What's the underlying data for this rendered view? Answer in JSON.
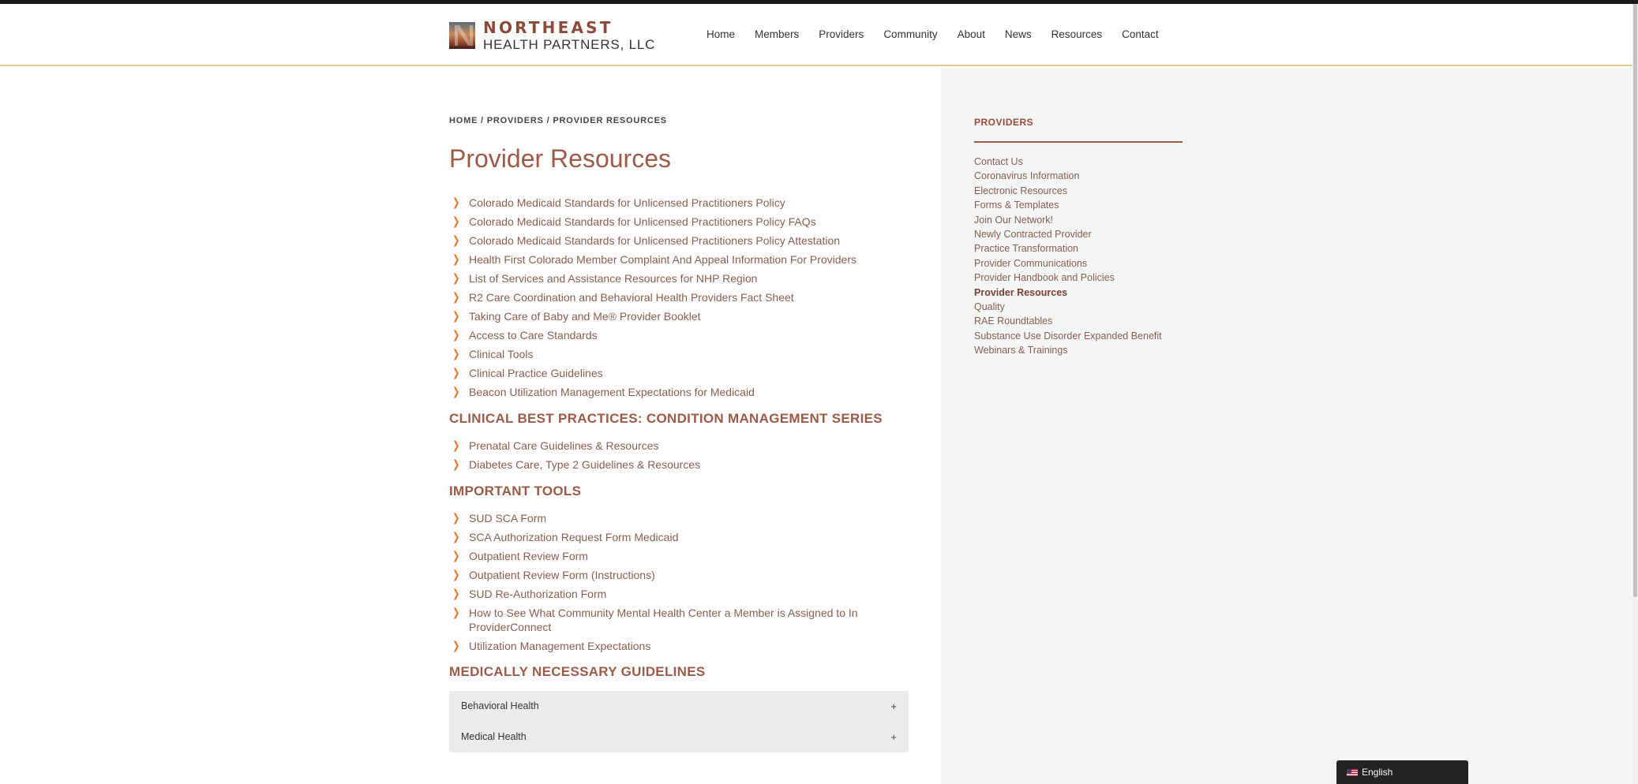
{
  "header": {
    "logo_line1": "NORTHEAST",
    "logo_line2": "HEALTH PARTNERS, LLC",
    "nav": [
      "Home",
      "Members",
      "Providers",
      "Community",
      "About",
      "News",
      "Resources",
      "Contact"
    ]
  },
  "breadcrumb": "HOME / PROVIDERS / PROVIDER RESOURCES",
  "page_title": "Provider Resources",
  "resources": [
    "Colorado Medicaid Standards for Unlicensed Practitioners Policy",
    "Colorado Medicaid Standards for Unlicensed Practitioners Policy FAQs",
    "Colorado Medicaid Standards for Unlicensed Practitioners Policy Attestation",
    "Health First Colorado Member Complaint And Appeal Information For Providers",
    "List of Services and Assistance Resources for NHP Region",
    "R2 Care Coordination and Behavioral Health Providers Fact Sheet",
    "Taking Care of Baby and Me® Provider Booklet",
    "Access to Care Standards",
    "Clinical Tools",
    "Clinical Practice Guidelines",
    "Beacon Utilization Management Expectations for Medicaid"
  ],
  "clinical_heading": "CLINICAL BEST PRACTICES: CONDITION MANAGEMENT SERIES",
  "clinical_items": [
    "Prenatal Care Guidelines & Resources",
    "Diabetes Care, Type 2 Guidelines & Resources"
  ],
  "tools_heading": "IMPORTANT TOOLS",
  "tools_items": [
    "SUD SCA Form",
    "SCA Authorization Request Form Medicaid",
    "Outpatient Review Form",
    "Outpatient Review Form (Instructions)",
    "SUD Re-Authorization Form",
    "How to See What Community Mental Health Center a Member is Assigned to In ProviderConnect",
    "Utilization Management Expectations"
  ],
  "guidelines_heading": "MEDICALLY NECESSARY GUIDELINES",
  "accordion": [
    "Behavioral Health",
    "Medical Health"
  ],
  "accordion_toggle": "+",
  "chevron": "❯",
  "sidebar": {
    "heading": "PROVIDERS",
    "items": [
      "Contact Us",
      "Coronavirus Information",
      "Electronic Resources",
      "Forms & Templates",
      "Join Our Network!",
      "Newly Contracted Provider",
      "Practice Transformation",
      "Provider Communications",
      "Provider Handbook and Policies",
      "Provider Resources",
      "Quality",
      "RAE Roundtables",
      "Substance Use Disorder Expanded Benefit",
      "Webinars & Trainings"
    ],
    "current": "Provider Resources"
  },
  "language": "English",
  "colors": {
    "brand": "#8c4a3a",
    "accent_orange": "#e0762a",
    "header_border": "#e6c88a",
    "sidebar_bg": "#f4f5f5"
  }
}
